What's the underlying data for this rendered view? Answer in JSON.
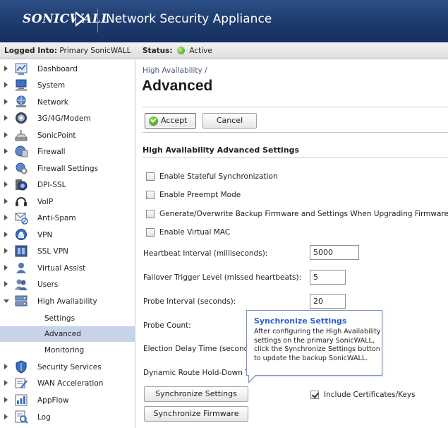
{
  "header": {
    "logo_text": "SONICWALL",
    "app_title": "Network Security Appliance"
  },
  "statusbar": {
    "logged_label": "Logged Into:",
    "logged_value": "Primary SonicWALL",
    "status_label": "Status:",
    "status_value": "Active",
    "status_color": "#2f9a14"
  },
  "sidebar": {
    "items": [
      {
        "label": "Dashboard",
        "icon": "dashboard-icon"
      },
      {
        "label": "System",
        "icon": "system-icon"
      },
      {
        "label": "Network",
        "icon": "network-icon"
      },
      {
        "label": "3G/4G/Modem",
        "icon": "modem-icon"
      },
      {
        "label": "SonicPoint",
        "icon": "sonicpoint-icon"
      },
      {
        "label": "Firewall",
        "icon": "firewall-icon"
      },
      {
        "label": "Firewall Settings",
        "icon": "firewall-settings-icon"
      },
      {
        "label": "DPI-SSL",
        "icon": "dpi-ssl-icon"
      },
      {
        "label": "VoIP",
        "icon": "voip-icon"
      },
      {
        "label": "Anti-Spam",
        "icon": "anti-spam-icon"
      },
      {
        "label": "VPN",
        "icon": "vpn-icon"
      },
      {
        "label": "SSL VPN",
        "icon": "ssl-vpn-icon"
      },
      {
        "label": "Virtual Assist",
        "icon": "virtual-assist-icon"
      },
      {
        "label": "Users",
        "icon": "users-icon"
      },
      {
        "label": "High Availability",
        "icon": "high-availability-icon"
      },
      {
        "label": "Security Services",
        "icon": "security-services-icon"
      },
      {
        "label": "WAN Acceleration",
        "icon": "wan-acceleration-icon"
      },
      {
        "label": "AppFlow",
        "icon": "appflow-icon"
      },
      {
        "label": "Log",
        "icon": "log-icon"
      }
    ],
    "subitems": [
      {
        "label": "Settings"
      },
      {
        "label": "Advanced"
      },
      {
        "label": "Monitoring"
      }
    ]
  },
  "main": {
    "breadcrumb": "High Availability /",
    "title": "Advanced",
    "accept_label": "Accept",
    "cancel_label": "Cancel",
    "section_title": "High Availability Advanced Settings",
    "checkboxes": [
      {
        "label": "Enable Stateful Synchronization",
        "checked": false
      },
      {
        "label": "Enable Preempt Mode",
        "checked": false
      },
      {
        "label": "Generate/Overwrite Backup Firmware and Settings When Upgrading Firmware",
        "checked": false
      },
      {
        "label": "Enable Virtual MAC",
        "checked": false
      }
    ],
    "fields": [
      {
        "label": "Heartbeat Interval (milliseconds):",
        "value": "5000"
      },
      {
        "label": "Failover Trigger Level (missed heartbeats):",
        "value": "5"
      },
      {
        "label": "Probe Interval (seconds):",
        "value": "20"
      },
      {
        "label": "Probe Count:",
        "value": ""
      },
      {
        "label": "Election Delay Time (seconds):",
        "value": ""
      },
      {
        "label": "Dynamic Route Hold-Down Time",
        "value": ""
      }
    ],
    "sync_settings_label": "Synchronize Settings",
    "sync_firmware_label": "Synchronize Firmware",
    "include_certs_label": "Include Certificates/Keys",
    "include_certs_checked": true
  },
  "tooltip": {
    "title": "Synchronize Settings",
    "body": "After configuring the High Availability settings on the primary SonicWALL, click the Synchronize Settings button to update the backup SonicWALL."
  }
}
